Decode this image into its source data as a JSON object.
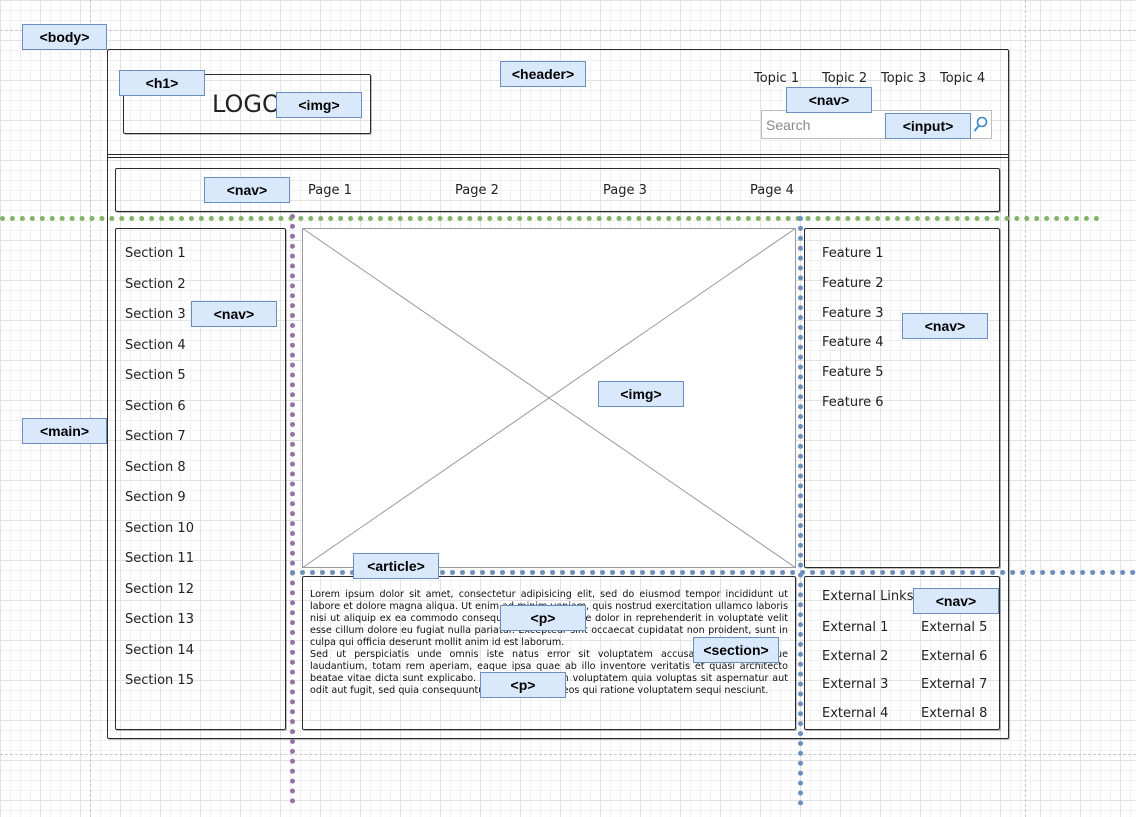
{
  "tags": {
    "body": "<body>",
    "main": "<main>",
    "h1": "<h1>",
    "logo_img": "<img>",
    "header": "<header>",
    "top_nav": "<nav>",
    "input": "<input>",
    "page_nav": "<nav>",
    "section_nav": "<nav>",
    "main_img": "<img>",
    "feature_nav": "<nav>",
    "article": "<article>",
    "p1": "<p>",
    "p2": "<p>",
    "section": "<section>",
    "external_nav": "<nav>"
  },
  "logo_text": "LOGO",
  "topics": [
    "Topic 1",
    "Topic 2",
    "Topic 3",
    "Topic 4"
  ],
  "search": {
    "placeholder": "Search"
  },
  "pages": [
    "Page 1",
    "Page 2",
    "Page 3",
    "Page 4"
  ],
  "sections": [
    "Section 1",
    "Section 2",
    "Section 3",
    "Section 4",
    "Section 5",
    "Section 6",
    "Section 7",
    "Section 8",
    "Section 9",
    "Section 10",
    "Section 11",
    "Section 12",
    "Section 13",
    "Section 14",
    "Section 15"
  ],
  "features": [
    "Feature 1",
    "Feature 2",
    "Feature 3",
    "Feature 4",
    "Feature 5",
    "Feature 6"
  ],
  "external": {
    "title": "External Links",
    "col1": [
      "External 1",
      "External 2",
      "External 3",
      "External 4"
    ],
    "col2": [
      "External 5",
      "External 6",
      "External 7",
      "External 8"
    ]
  },
  "paragraphs": {
    "p1": "Lorem ipsum dolor sit amet, consectetur adipisicing elit, sed do eiusmod tempor incididunt ut labore et dolore magna aliqua. Ut enim ad minim veniam, quis nostrud exercitation ullamco laboris nisi ut aliquip ex ea commodo consequat. Duis aute irure dolor in reprehenderit in voluptate velit esse cillum dolore eu fugiat nulla pariatur. Excepteur sint occaecat cupidatat non proident, sunt in culpa qui officia deserunt mollit anim id est laborum.",
    "p2": "Sed ut perspiciatis unde omnis iste natus error sit voluptatem accusantium doloremque laudantium, totam rem aperiam, eaque ipsa quae ab illo inventore veritatis et quasi architecto beatae vitae dicta sunt explicabo. Nemo enim ipsam voluptatem quia voluptas sit aspernatur aut odit aut fugit, sed quia consequuntur magni dolores eos qui ratione voluptatem sequi nesciunt."
  },
  "colors": {
    "tag_fill": "#dae8fc",
    "tag_stroke": "#6c8ebf",
    "green_guide": "#82b366",
    "purple_guide": "#9673a6",
    "blue_guide": "#6c8ebf"
  }
}
